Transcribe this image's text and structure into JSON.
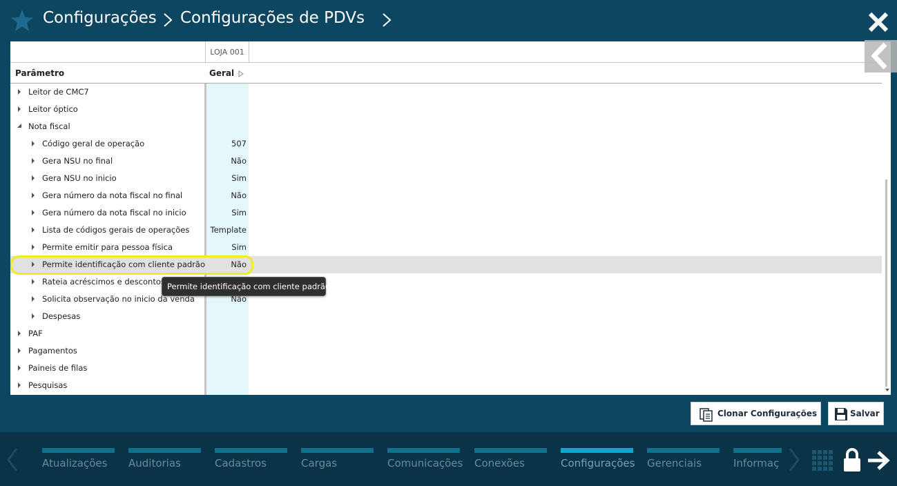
{
  "header": {
    "breadcrumb_1": "Configurações",
    "breadcrumb_2": "Configurações de PDVs"
  },
  "grid": {
    "store_column": "LOJA 001",
    "param_header": "Parâmetro",
    "value_header": "Geral",
    "rows": [
      {
        "label": "Leitor de CMC7",
        "value": "",
        "level": 0,
        "expanded": false
      },
      {
        "label": "Leitor óptico",
        "value": "",
        "level": 0,
        "expanded": false
      },
      {
        "label": "Nota fiscal",
        "value": "",
        "level": 0,
        "expanded": true
      },
      {
        "label": "Código geral de operação",
        "value": "507",
        "level": 1,
        "expanded": false
      },
      {
        "label": "Gera NSU no final",
        "value": "Não",
        "level": 1,
        "expanded": false
      },
      {
        "label": "Gera NSU no inicio",
        "value": "Sim",
        "level": 1,
        "expanded": false
      },
      {
        "label": "Gera número da nota fiscal no final",
        "value": "Não",
        "level": 1,
        "expanded": false
      },
      {
        "label": "Gera número da nota fiscal no inicio",
        "value": "Sim",
        "level": 1,
        "expanded": false
      },
      {
        "label": "Lista de códigos gerais de operações",
        "value": "Template",
        "level": 1,
        "expanded": false
      },
      {
        "label": "Permite emitir para pessoa física",
        "value": "Sim",
        "level": 1,
        "expanded": false
      },
      {
        "label": "Permite identificação com cliente padrão",
        "value": "Não",
        "level": 1,
        "expanded": false,
        "selected": true
      },
      {
        "label": "Rateia acréscimos e descontos",
        "value": "",
        "level": 1,
        "expanded": false
      },
      {
        "label": "Solicita observação no inicio da venda",
        "value": "Não",
        "level": 1,
        "expanded": false
      },
      {
        "label": "Despesas",
        "value": "",
        "level": 1,
        "expanded": false
      },
      {
        "label": "PAF",
        "value": "",
        "level": 0,
        "expanded": false
      },
      {
        "label": "Pagamentos",
        "value": "",
        "level": 0,
        "expanded": false
      },
      {
        "label": "Paineis de filas",
        "value": "",
        "level": 0,
        "expanded": false
      },
      {
        "label": "Pesquisas",
        "value": "",
        "level": 0,
        "expanded": false
      }
    ],
    "tooltip": "Permite identificação com cliente padrão"
  },
  "actions": {
    "clone_label": "Clonar Configurações",
    "save_label": "Salvar"
  },
  "nav": {
    "items": [
      {
        "label": "Atualizações",
        "active": false
      },
      {
        "label": "Auditorias",
        "active": false
      },
      {
        "label": "Cadastros",
        "active": false
      },
      {
        "label": "Cargas",
        "active": false
      },
      {
        "label": "Comunicações",
        "active": false
      },
      {
        "label": "Conexões",
        "active": false
      },
      {
        "label": "Configurações",
        "active": true
      },
      {
        "label": "Gerenciais",
        "active": false
      },
      {
        "label": "Informaç",
        "active": false
      }
    ]
  },
  "colors": {
    "background": "#0d4660",
    "navbar": "#0a3348",
    "nav_bar": "#10718e",
    "nav_bar_active": "#14a6cc",
    "value_column": "#e4f8fb",
    "highlight": "#f2ec1d"
  }
}
